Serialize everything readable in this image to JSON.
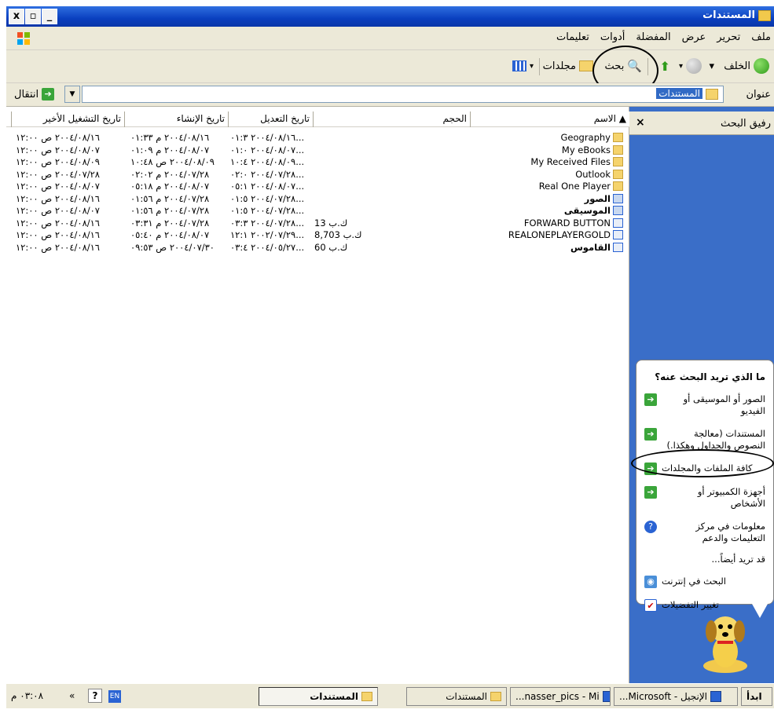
{
  "window": {
    "title": "المستندات",
    "buttons": {
      "close": "x",
      "restore": "▫",
      "minimize": "_"
    }
  },
  "menu": [
    "ملف",
    "تحرير",
    "عرض",
    "المفضلة",
    "أدوات",
    "تعليمات"
  ],
  "toolbar": {
    "back": "الخلف",
    "search": "بحث",
    "folders": "مجلدات"
  },
  "address": {
    "label": "عنوان",
    "value": "المستندات",
    "go": "انتقال"
  },
  "columns": {
    "name": "الاسم",
    "size": "الحجم",
    "modified": "تاريخ التعديل",
    "created": "تاريخ الإنشاء",
    "last_run": "تاريخ التشغيل الأخير"
  },
  "files": [
    {
      "name": "Geography",
      "size": "",
      "modified": "٢٠٠٤/٠٨/١٦ ٠١:٣...",
      "created": "٢٠٠٤/٠٨/١٦ م ٠١:٣٣",
      "last": "٢٠٠٤/٠٨/١٦ ص ١٢:٠٠",
      "type": "folder"
    },
    {
      "name": "My eBooks",
      "size": "",
      "modified": "٢٠٠٤/٠٨/٠٧ ٠١:٠...",
      "created": "٢٠٠٤/٠٨/٠٧ م ٠١:٠٩",
      "last": "٢٠٠٤/٠٨/٠٧ ص ١٢:٠٠",
      "type": "folder"
    },
    {
      "name": "My Received Files",
      "size": "",
      "modified": "٢٠٠٤/٠٨/٠٩ ١٠:٤...",
      "created": "٢٠٠٤/٠٨/٠٩ ص ١٠:٤٨",
      "last": "٢٠٠٤/٠٨/٠٩ ص ١٢:٠٠",
      "type": "folder"
    },
    {
      "name": "Outlook",
      "size": "",
      "modified": "٢٠٠٤/٠٧/٢٨ ٠٢:٠...",
      "created": "٢٠٠٤/٠٧/٢٨ م ٠٢:٠٢",
      "last": "٢٠٠٤/٠٧/٢٨ ص ١٢:٠٠",
      "type": "folder"
    },
    {
      "name": "Real One Player",
      "size": "",
      "modified": "٢٠٠٤/٠٨/٠٧ ٠٥:١...",
      "created": "٢٠٠٤/٠٨/٠٧ م ٠٥:١٨",
      "last": "٢٠٠٤/٠٨/٠٧ ص ١٢:٠٠",
      "type": "folder"
    },
    {
      "name": "الصور",
      "size": "",
      "modified": "٢٠٠٤/٠٧/٢٨ ٠١:٥...",
      "created": "٢٠٠٤/٠٧/٢٨ م ٠١:٥٦",
      "last": "٢٠٠٤/٠٨/١٦ ص ١٢:٠٠",
      "type": "special"
    },
    {
      "name": "الموسيقى",
      "size": "",
      "modified": "٢٠٠٤/٠٧/٢٨ ٠١:٥...",
      "created": "٢٠٠٤/٠٧/٢٨ م ٠١:٥٦",
      "last": "٢٠٠٤/٠٨/٠٧ ص ١٢:٠٠",
      "type": "special"
    },
    {
      "name": "FORWARD BUTTON",
      "size": "13 ك.ب",
      "modified": "٢٠٠٤/٠٧/٢٨ ٠٣:٣...",
      "created": "٢٠٠٤/٠٧/٢٨ م ٠٣:٣١",
      "last": "٢٠٠٤/٠٨/١٦ ص ١٢:٠٠",
      "type": "file"
    },
    {
      "name": "REALONEPLAYERGOLD",
      "size": "8,703 ك.ب",
      "modified": "٢٠٠٢/٠٧/٢٩ ١٢:١...",
      "created": "٢٠٠٤/٠٨/٠٧ م ٠٥:٤٠",
      "last": "٢٠٠٤/٠٨/١٦ ص ١٢:٠٠",
      "type": "file"
    },
    {
      "name": "القاموس",
      "size": "60 ك.ب",
      "modified": "٢٠٠٤/٠٥/٢٧ ٠٣:٤...",
      "created": "٢٠٠٤/٠٧/٣٠ ص ٠٩:٥٣",
      "last": "٢٠٠٤/٠٨/١٦ ص ١٢:٠٠",
      "type": "file"
    }
  ],
  "search_pane": {
    "title": "رفيق البحث",
    "close": "×",
    "question": "ما الذي تريد البحث عنه؟",
    "options": [
      "الصور أو الموسيقى أو الفيديو",
      "المستندات (معالجة النصوص والجداول وهكذا.)",
      "كافة الملفات والمجلدات",
      "أجهزة الكمبيوتر أو الأشخاص",
      "معلومات في مركز التعليمات والدعم"
    ],
    "also_label": "قد تريد أيضاً...",
    "extra": [
      "البحث في إنترنت",
      "تغيير التفضيلات"
    ]
  },
  "taskbar": {
    "start": "ابدأ",
    "buttons": [
      "الإنجيل - Microsoft...",
      "nasser_pics - Mi...",
      "المستندات",
      "المستندات"
    ],
    "lang": "EN",
    "clock": "٠٣:٠٨ م",
    "chevron": "»"
  }
}
